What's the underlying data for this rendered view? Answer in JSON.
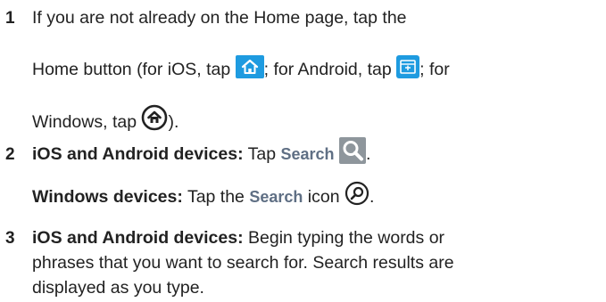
{
  "steps": [
    {
      "number": "1",
      "line1": "If you are not already on the Home page, tap the",
      "line2_a": "Home button (for iOS, tap ",
      "line2_b": "; for Android, tap ",
      "line2_c": "; for",
      "line3_a": "Windows, tap ",
      "line3_b": ")."
    },
    {
      "number": "2",
      "bold_a": "iOS and Android devices:",
      "text_a": " Tap ",
      "ui_a": "Search",
      "end_a": ".",
      "bold_b": "Windows devices:",
      "text_b": " Tap the ",
      "ui_b": "Search",
      "text_b2": " icon ",
      "end_b": "."
    },
    {
      "number": "3",
      "bold": "iOS and Android devices:",
      "line1": " Begin typing the words or",
      "line2": "phrases that you want to search for. Search results are",
      "line3": "displayed as you type."
    }
  ],
  "icons": {
    "ios_home": "home-icon",
    "android_home": "android-home-icon",
    "windows_home": "windows-home-icon",
    "search": "magnifier-icon",
    "windows_search": "windows-search-icon"
  },
  "colors": {
    "icon_blue": "#1e9be0",
    "ui_word": "#5f6f84",
    "search_gray": "#8e969c"
  }
}
